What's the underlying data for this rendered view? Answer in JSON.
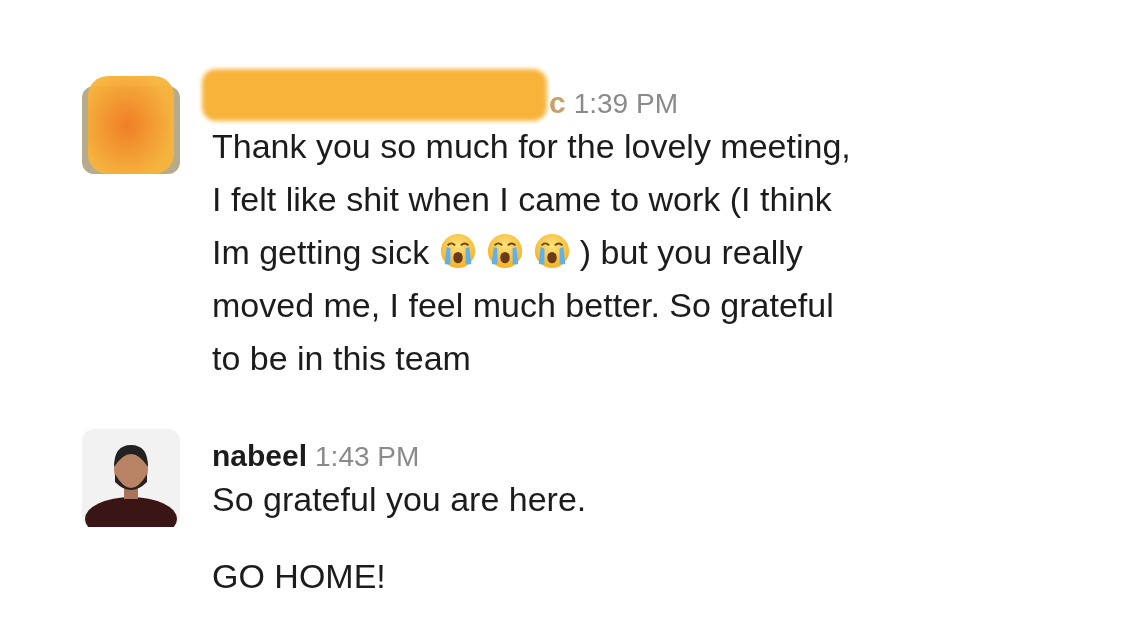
{
  "messages": [
    {
      "author": "c",
      "redacted": true,
      "time": "1:39 PM",
      "paragraphs": [
        [
          {
            "kind": "text",
            "text": "Thank you so much for the lovely meeting,\nI felt like shit when I came to work (I think\nIm getting sick "
          },
          {
            "kind": "emoji"
          },
          {
            "kind": "emoji"
          },
          {
            "kind": "emoji"
          },
          {
            "kind": "text",
            "text": ") but you really\nmoved me, I feel much better. So grateful\nto be in this team"
          }
        ]
      ]
    },
    {
      "author": "nabeel",
      "redacted": false,
      "time": "1:43 PM",
      "paragraphs": [
        [
          {
            "kind": "text",
            "text": "So grateful you are here."
          }
        ],
        [
          {
            "kind": "text",
            "text": "GO HOME!"
          }
        ]
      ]
    }
  ]
}
